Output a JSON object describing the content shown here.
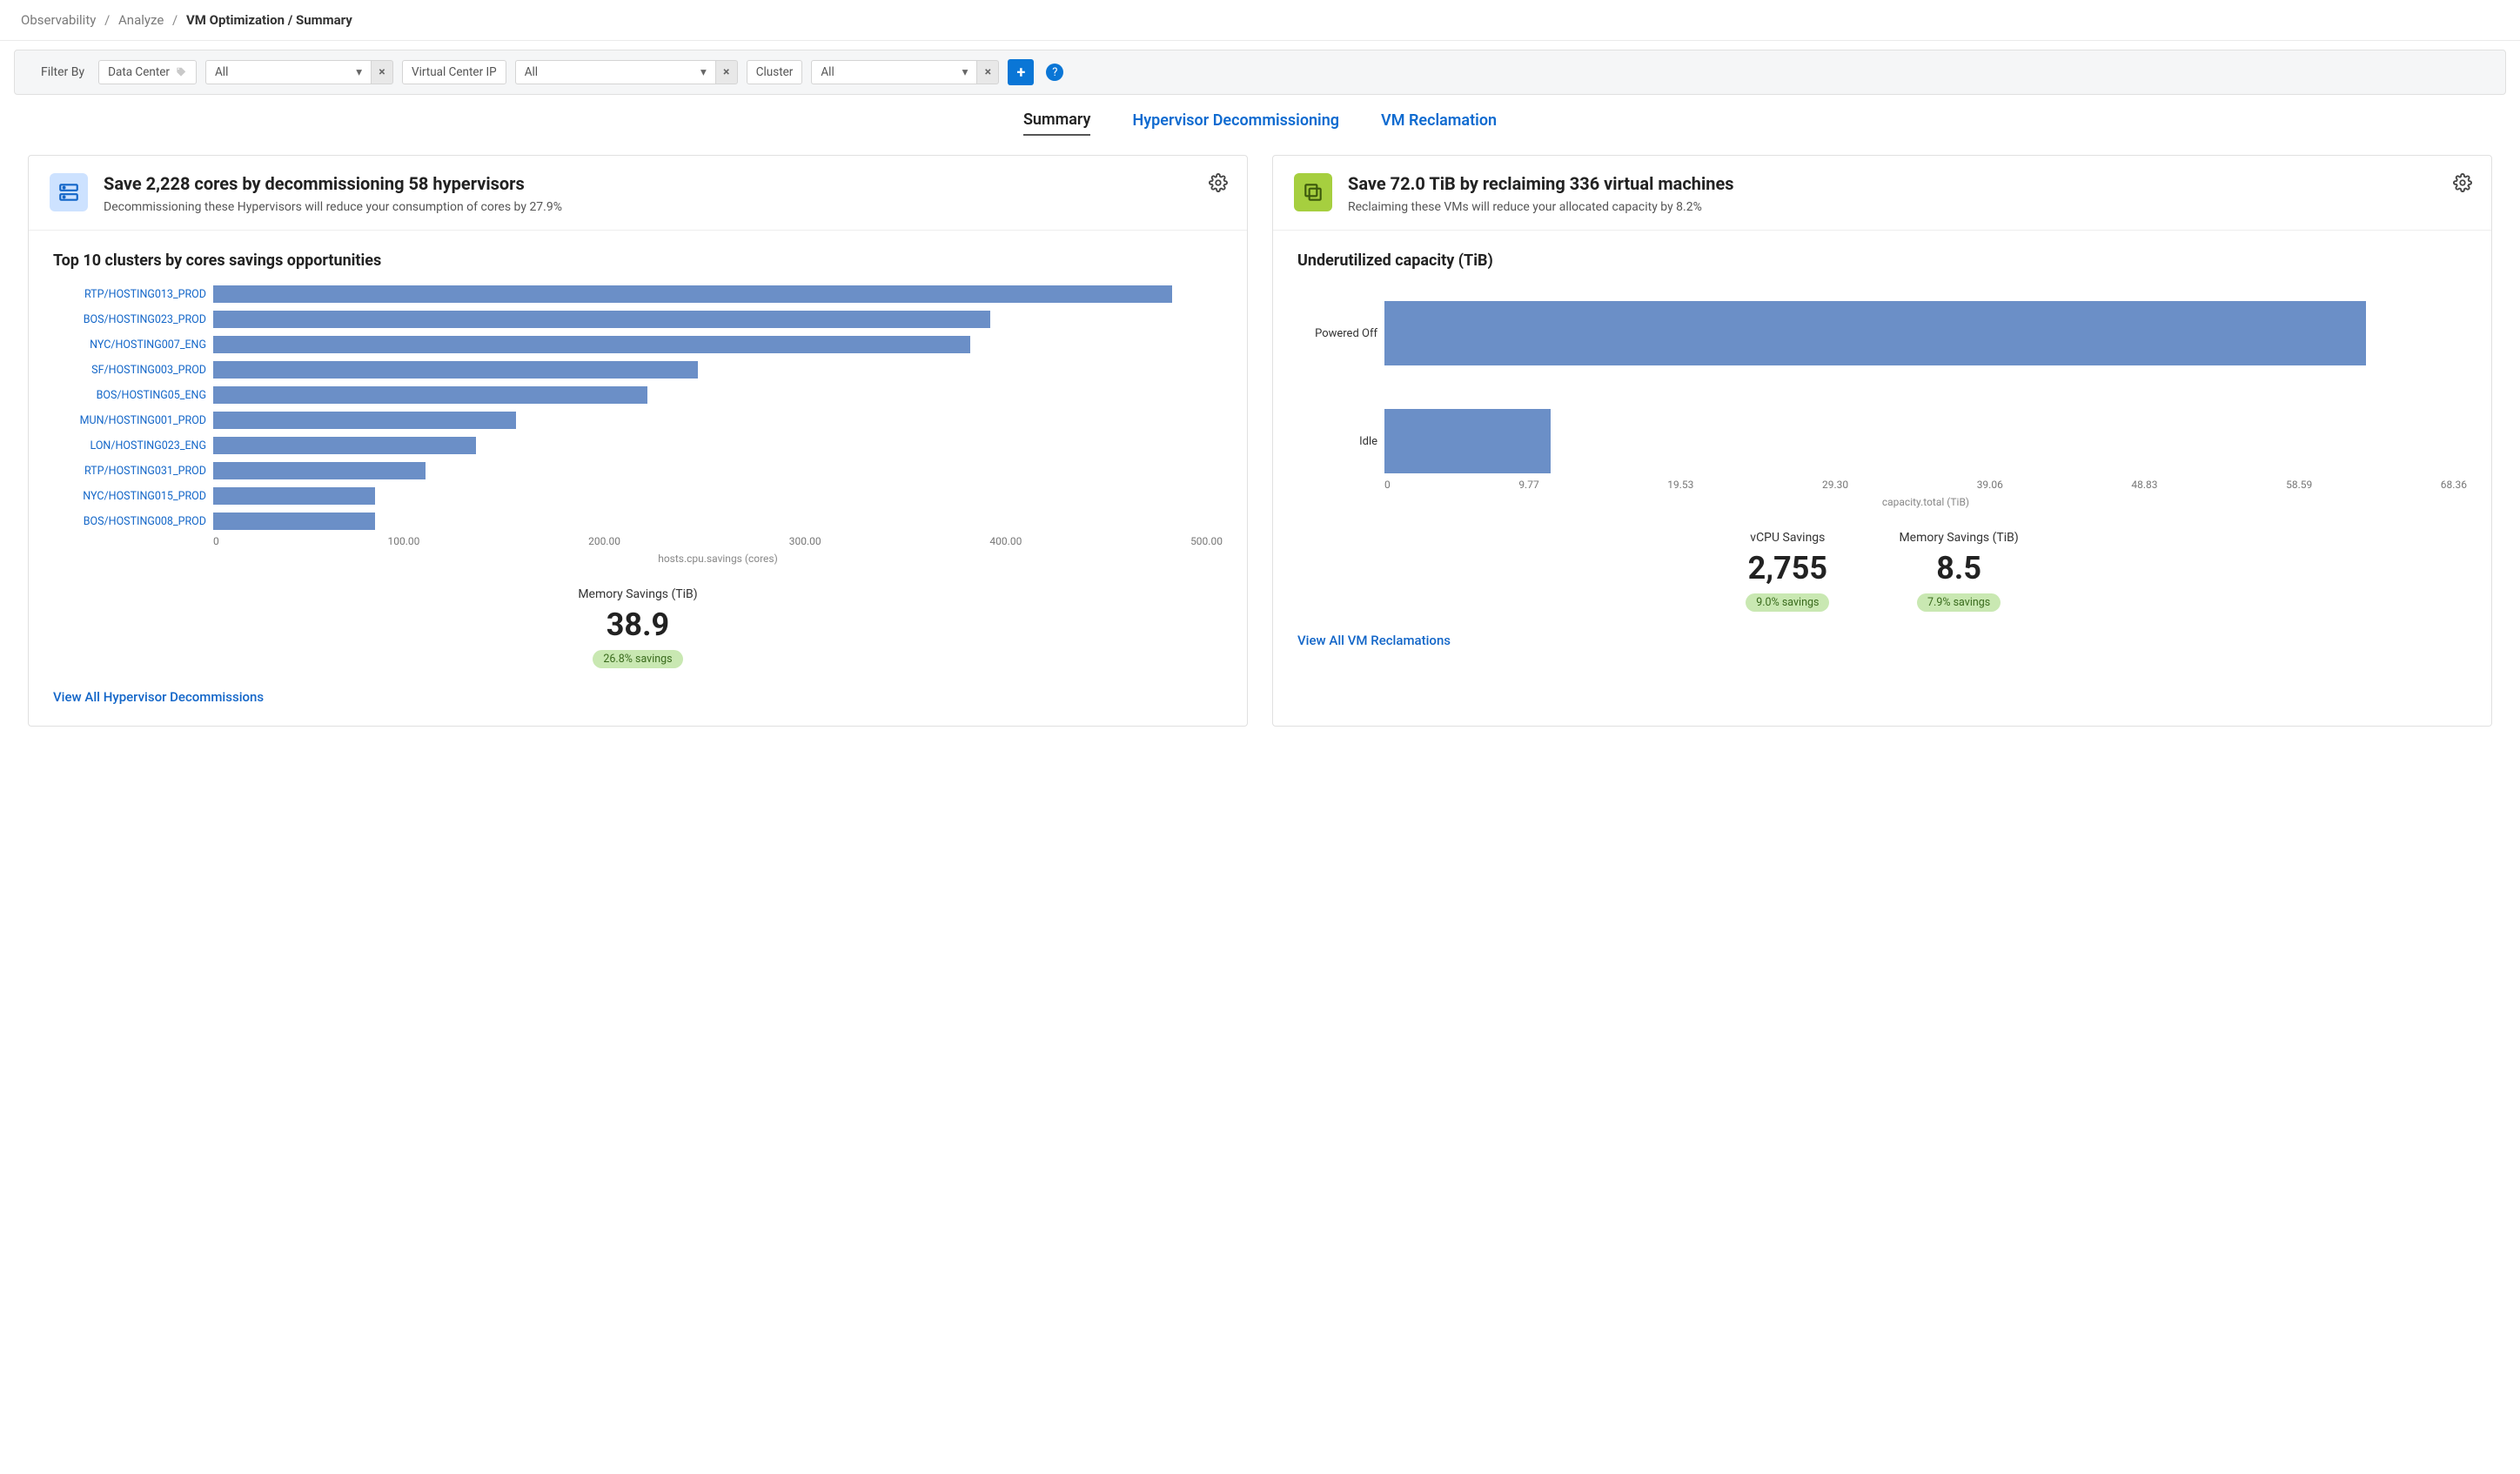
{
  "breadcrumb": {
    "a": "Observability",
    "b": "Analyze",
    "c": "VM Optimization / Summary"
  },
  "filter": {
    "label": "Filter By",
    "items": [
      {
        "name": "Data Center",
        "value": "All"
      },
      {
        "name": "Virtual Center IP",
        "value": "All"
      },
      {
        "name": "Cluster",
        "value": "All"
      }
    ]
  },
  "tabs": [
    "Summary",
    "Hypervisor Decommissioning",
    "VM Reclamation"
  ],
  "left": {
    "title": "Save 2,228 cores by decommissioning 58 hypervisors",
    "sub": "Decommissioning these Hypervisors will reduce your consumption of cores by 27.9%",
    "section": "Top 10 clusters by cores savings opportunities",
    "axis_label": "hosts.cpu.savings (cores)",
    "axis_ticks": [
      "0",
      "100.00",
      "200.00",
      "300.00",
      "400.00",
      "500.00"
    ],
    "metric": {
      "label": "Memory Savings (TiB)",
      "value": "38.9",
      "badge": "26.8% savings"
    },
    "footer": "View All Hypervisor Decommissions"
  },
  "right": {
    "title": "Save 72.0 TiB by reclaiming 336 virtual machines",
    "sub": "Reclaiming these VMs will reduce your allocated capacity by 8.2%",
    "section": "Underutilized capacity (TiB)",
    "axis_label": "capacity.total (TiB)",
    "axis_ticks": [
      "0",
      "9.77",
      "19.53",
      "29.30",
      "39.06",
      "48.83",
      "58.59",
      "68.36"
    ],
    "metrics": [
      {
        "label": "vCPU Savings",
        "value": "2,755",
        "badge": "9.0% savings"
      },
      {
        "label": "Memory Savings (TiB)",
        "value": "8.5",
        "badge": "7.9% savings"
      }
    ],
    "footer": "View All VM Reclamations"
  },
  "chart_data": [
    {
      "type": "bar",
      "orientation": "horizontal",
      "title": "Top 10 clusters by cores savings opportunities",
      "xlabel": "hosts.cpu.savings (cores)",
      "xlim": [
        0,
        500
      ],
      "categories": [
        "RTP/HOSTING013_PROD",
        "BOS/HOSTING023_PROD",
        "NYC/HOSTING007_ENG",
        "SF/HOSTING003_PROD",
        "BOS/HOSTING05_ENG",
        "MUN/HOSTING001_PROD",
        "LON/HOSTING023_ENG",
        "RTP/HOSTING031_PROD",
        "NYC/HOSTING015_PROD",
        "BOS/HOSTING008_PROD"
      ],
      "values": [
        475,
        385,
        375,
        240,
        215,
        150,
        130,
        105,
        80,
        80
      ]
    },
    {
      "type": "bar",
      "orientation": "horizontal",
      "title": "Underutilized capacity (TiB)",
      "xlabel": "capacity.total (TiB)",
      "xlim": [
        0,
        68.36
      ],
      "categories": [
        "Powered Off",
        "Idle"
      ],
      "values": [
        62,
        10.5
      ]
    }
  ]
}
